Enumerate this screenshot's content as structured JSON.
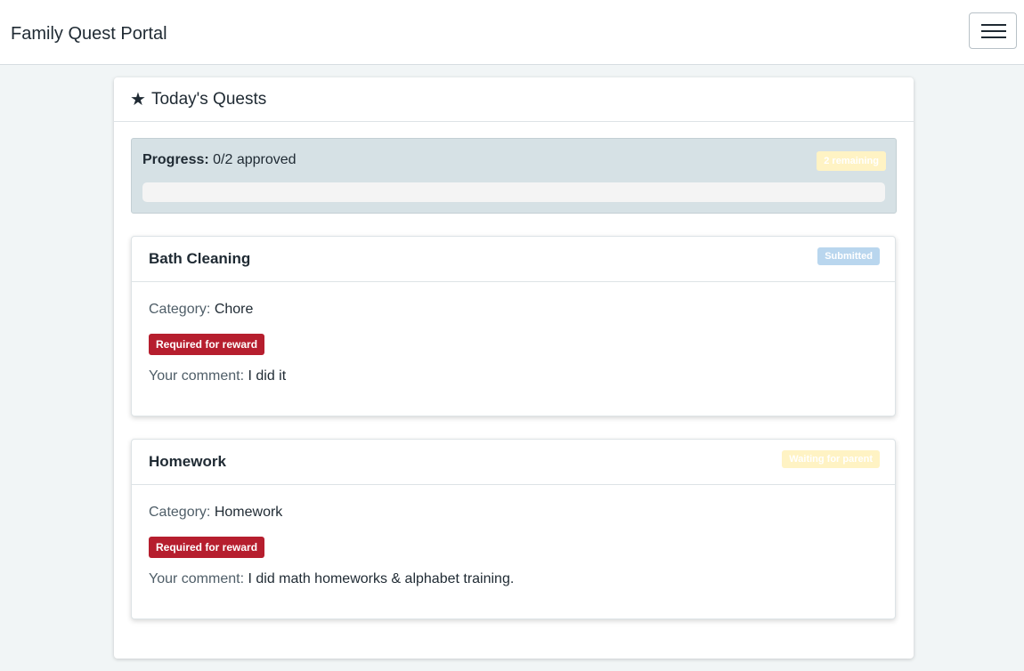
{
  "app": {
    "title": "Family Quest Portal"
  },
  "panel": {
    "title": "Today's Quests"
  },
  "progress": {
    "label": "Progress:",
    "value_text": "0/2 approved",
    "remaining": "2 remaining",
    "fraction": 0
  },
  "quests": [
    {
      "title": "Bath Cleaning",
      "status": "Submitted",
      "status_color": "#b9d6ee",
      "category_label": "Category:",
      "category": "Chore",
      "required": "Required for reward",
      "comment_label": "Your comment:",
      "comment": "I did it"
    },
    {
      "title": "Homework",
      "status": "Waiting for parent",
      "status_color": "#fff3c4",
      "category_label": "Category:",
      "category": "Homework",
      "required": "Required for reward",
      "comment_label": "Your comment:",
      "comment": "I did math homeworks & alphabet training."
    }
  ],
  "colors": {
    "accent_required": "#b61e2e",
    "progress_box": "#d6e1e5"
  }
}
